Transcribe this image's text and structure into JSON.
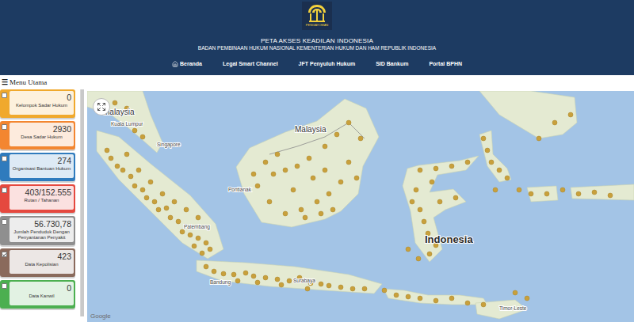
{
  "header": {
    "logo_caption": "PENGAYOMAN",
    "title": "PETA AKSES KEADILAN INDONESIA",
    "subtitle": "BADAN PEMBINAAN HUKUM NASIONAL KEMENTERIAN HUKUM DAN HAM REPUBLIK INDONESIA"
  },
  "nav": [
    {
      "label": "Beranda",
      "icon": true
    },
    {
      "label": "Legal Smart Channel",
      "icon": false
    },
    {
      "label": "JFT Penyuluh Hukum",
      "icon": false
    },
    {
      "label": "SID Bankum",
      "icon": false
    },
    {
      "label": "Portal BPHN",
      "icon": false
    }
  ],
  "sidebar": {
    "menu_icon": "☰",
    "title": "Menu Utama",
    "items": [
      {
        "label": "Kelompok Sadar Hukum",
        "value": "0",
        "checked": false,
        "color": "#f0a92d"
      },
      {
        "label": "Desa Sadar Hukum",
        "value": "2930",
        "checked": false,
        "color": "#f38630"
      },
      {
        "label": "Organisasi Bantuan Hukum",
        "value": "274",
        "checked": false,
        "color": "#2f7bbd"
      },
      {
        "label": "Rutan / Tahanan",
        "value": "403/152.555",
        "checked": false,
        "color": "#e5493f"
      },
      {
        "label": "Jumlah Penduduk Dengan Penyantanan Penyakit",
        "value": "56.730,78",
        "checked": false,
        "color": "#8f8f8f"
      },
      {
        "label": "Data Kepolisian",
        "value": "423",
        "checked": true,
        "color": "#8a6a5c"
      },
      {
        "label": "Data Kanwil",
        "value": "0",
        "checked": false,
        "color": "#4caf50"
      }
    ]
  },
  "map": {
    "labels": [
      {
        "text": "Malaysia",
        "kind": "country"
      },
      {
        "text": "Kuala Lumpur",
        "kind": "city"
      },
      {
        "text": "Singapore",
        "kind": "city"
      },
      {
        "text": "Malaysia",
        "kind": "country"
      },
      {
        "text": "Pontianak",
        "kind": "city"
      },
      {
        "text": "Palembang",
        "kind": "city"
      },
      {
        "text": "Indonesia",
        "kind": "major"
      },
      {
        "text": "Bandung",
        "kind": "city"
      },
      {
        "text": "Surabaya",
        "kind": "city"
      },
      {
        "text": "Timor-Leste",
        "kind": "city"
      }
    ],
    "attribution": "Google"
  }
}
